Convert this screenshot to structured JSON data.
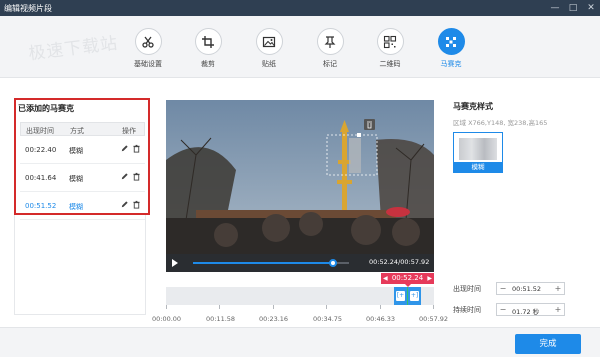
{
  "window": {
    "title": "编辑视频片段",
    "minimize": "—",
    "maximize": "□",
    "close": "✕"
  },
  "watermark": "极速下载站",
  "toolbar": {
    "items": [
      {
        "label": "基础设置",
        "icon": "scissors-icon"
      },
      {
        "label": "裁剪",
        "icon": "crop-icon"
      },
      {
        "label": "贴纸",
        "icon": "image-icon"
      },
      {
        "label": "标记",
        "icon": "pin-icon"
      },
      {
        "label": "二维码",
        "icon": "qrcode-icon"
      },
      {
        "label": "马赛克",
        "icon": "mosaic-icon",
        "active": true
      }
    ],
    "accent": "#1e8ae8"
  },
  "left_panel": {
    "title": "已添加的马赛克",
    "columns": [
      "出现时间",
      "方式",
      "操作"
    ],
    "rows": [
      {
        "time": "00:22.40",
        "mode": "模糊",
        "selected": false
      },
      {
        "time": "00:41.64",
        "mode": "模糊",
        "selected": false
      },
      {
        "time": "00:51.52",
        "mode": "模糊",
        "selected": true
      }
    ]
  },
  "player": {
    "time_readout": "00:52.24/00:57.92",
    "progress": 0.9,
    "badge_time": "00:52.24",
    "badge_left": "◀",
    "badge_right": "▶",
    "segment_start_tag": "[+",
    "segment_end_tag": "+]"
  },
  "ruler": {
    "labels": [
      "00:00.00",
      "00:11.58",
      "00:23.16",
      "00:34.75",
      "00:46.33",
      "00:57.92"
    ]
  },
  "right_panel": {
    "title": "马赛克样式",
    "region": "区域 X766,Y148, 宽238,高165",
    "style_label": "模糊",
    "appear_label": "出现时间",
    "appear_value": "00:51.52",
    "duration_label": "持续时间",
    "duration_value": "01.72 秒",
    "minus": "−",
    "plus": "+"
  },
  "footer": {
    "done_label": "完成"
  }
}
